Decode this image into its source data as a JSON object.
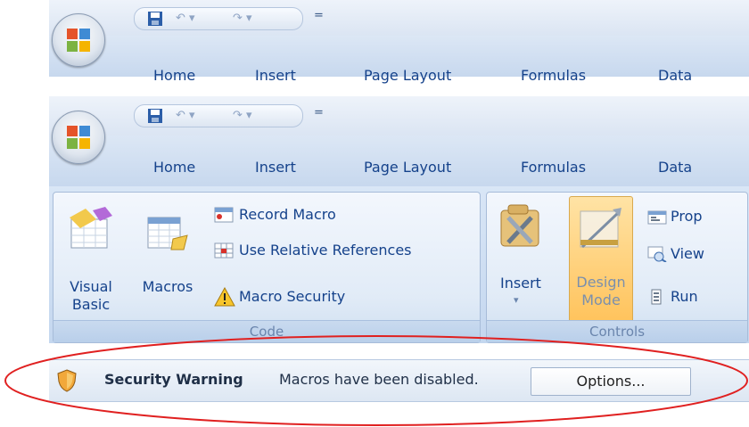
{
  "tabs": [
    "Home",
    "Insert",
    "Page Layout",
    "Formulas",
    "Data"
  ],
  "quick_access": {
    "save_icon": "save-icon",
    "undo_icon": "undo-icon",
    "redo_icon": "redo-icon",
    "customize_icon": "customize-quick-access-icon"
  },
  "code_group": {
    "label": "Code",
    "visual_basic": "Visual Basic",
    "macros": "Macros",
    "record_macro": "Record Macro",
    "use_relative_references": "Use Relative References",
    "macro_security": "Macro Security"
  },
  "controls_group": {
    "label": "Controls",
    "insert": "Insert",
    "design_mode": "Design Mode",
    "properties": "Prop",
    "view_code": "View",
    "run_dialog": "Run"
  },
  "security_bar": {
    "title": "Security Warning",
    "message": "Macros have been disabled.",
    "options_button": "Options..."
  },
  "colors": {
    "tab_text": "#15428b",
    "annotation_ellipse": "#e02020",
    "design_mode_highlight": "#ffc35c"
  }
}
